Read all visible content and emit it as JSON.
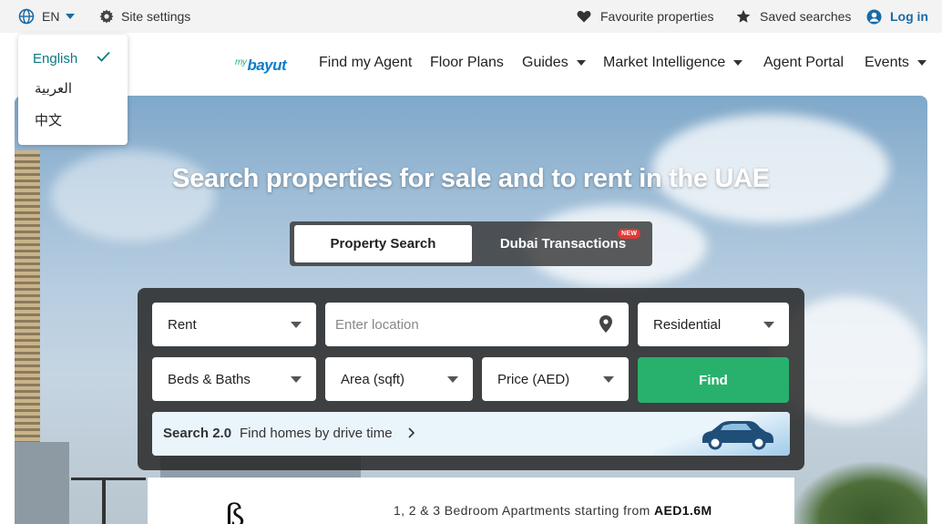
{
  "topbar": {
    "language_code": "EN",
    "site_settings": "Site settings",
    "favourites": "Favourite properties",
    "saved_searches": "Saved searches",
    "login": "Log in"
  },
  "language_menu": {
    "options": [
      "English",
      "العربية",
      "中文"
    ],
    "selected": "English"
  },
  "nav": {
    "mybayut_prefix": "my",
    "mybayut_name": "bayut",
    "links": [
      {
        "label": "Find my Agent"
      },
      {
        "label": "Floor Plans"
      },
      {
        "label": "Guides"
      },
      {
        "label": "Market Intelligence"
      },
      {
        "label": "Agent Portal"
      },
      {
        "label": "Events"
      }
    ]
  },
  "hero": {
    "headline": "Search properties for sale and to rent in the UAE",
    "tabs": {
      "active": "Property Search",
      "inactive": "Dubai Transactions",
      "badge": "NEW"
    },
    "search": {
      "purpose": "Rent",
      "location_placeholder": "Enter location",
      "category": "Residential",
      "beds_baths": "Beds & Baths",
      "area": "Area (sqft)",
      "price": "Price (AED)",
      "find_button": "Find",
      "search2_title": "Search 2.0",
      "search2_text": "Find homes by drive time"
    },
    "promo": {
      "text": "1, 2 & 3 Bedroom Apartments starting from",
      "price": "AED1.6M"
    }
  },
  "colors": {
    "brand_green": "#28b16d",
    "link_blue": "#1a6aa5",
    "badge_red": "#e53935"
  }
}
